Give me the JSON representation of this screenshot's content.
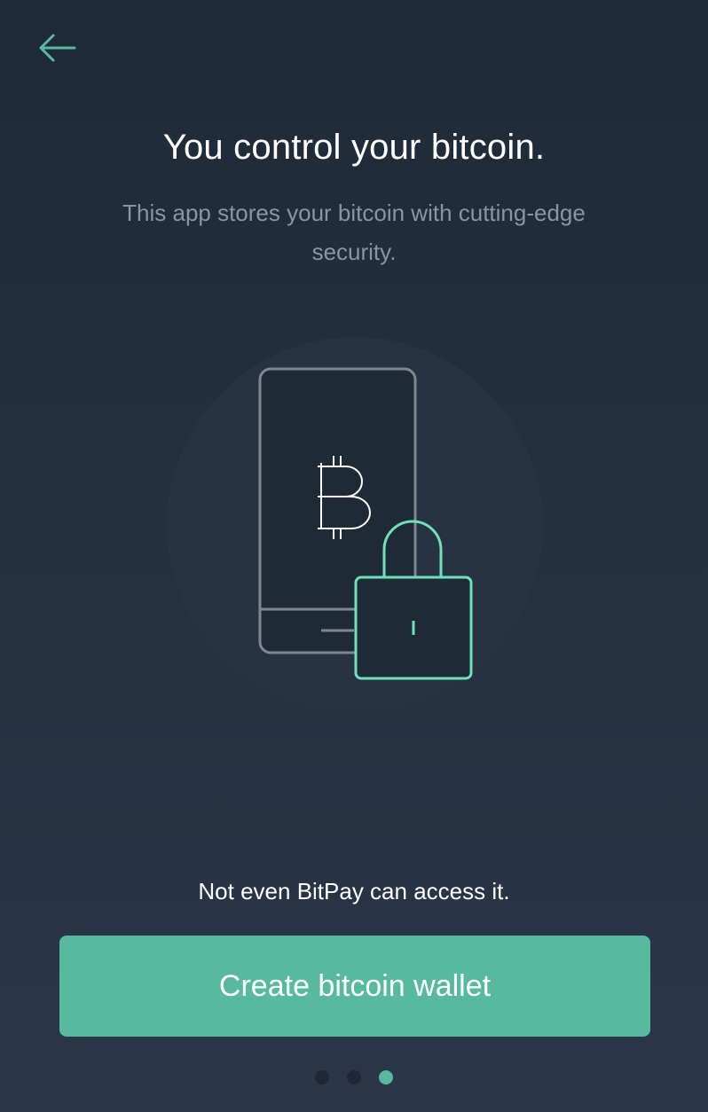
{
  "header": {
    "back_icon": "arrow-left-icon"
  },
  "slide": {
    "title": "You control your bitcoin.",
    "subtitle": "This app stores your bitcoin with cutting-edge security.",
    "illustration_icons": [
      "phone-icon",
      "bitcoin-icon",
      "padlock-icon"
    ],
    "caption": "Not even BitPay can access it."
  },
  "actions": {
    "create_wallet_label": "Create bitcoin wallet"
  },
  "pager": {
    "total": 3,
    "active_index": 2
  },
  "colors": {
    "accent": "#57b99d",
    "background_top": "#1e2a37",
    "background_bottom": "#2b3749",
    "subtitle_text": "#8a95a3",
    "lock_stroke": "#6fe0b8"
  }
}
